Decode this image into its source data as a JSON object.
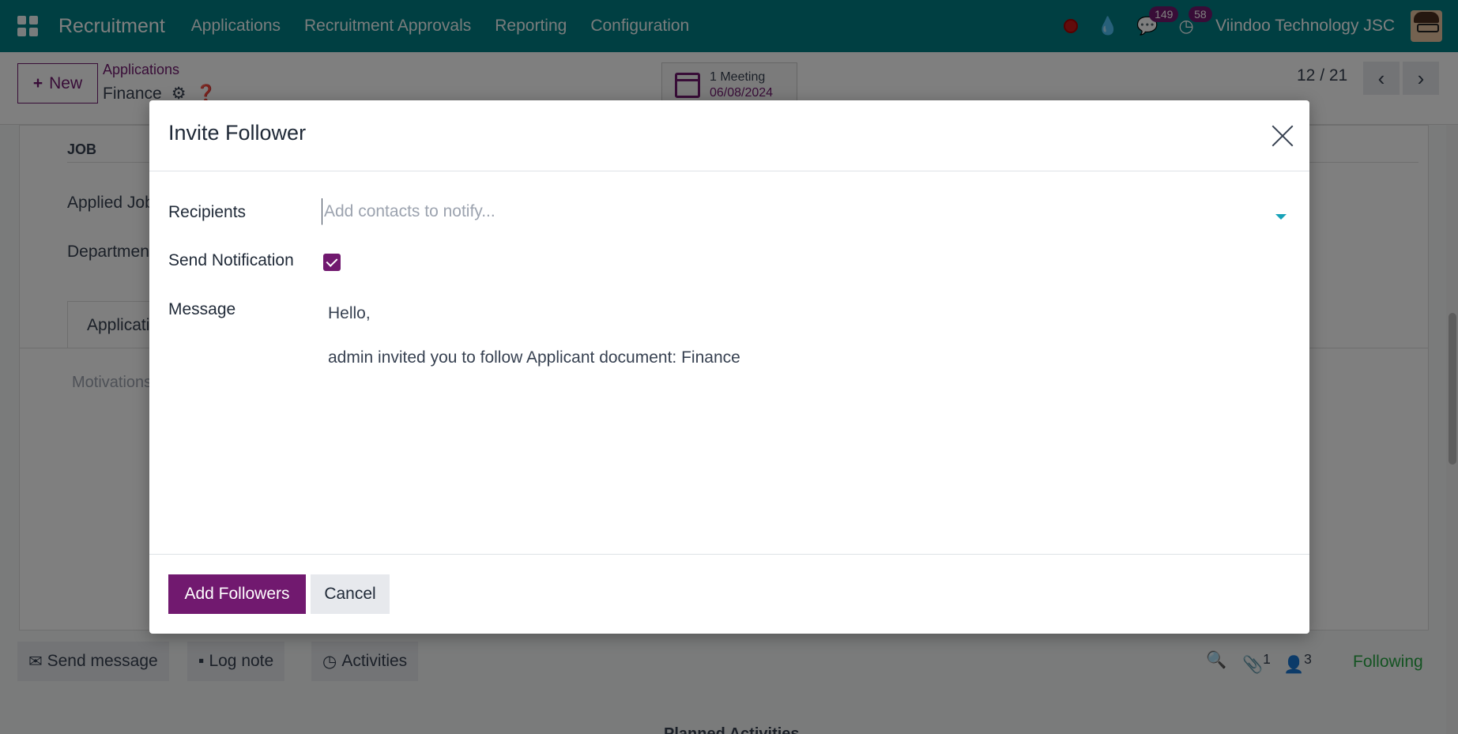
{
  "navbar": {
    "app_name": "Recruitment",
    "menu": [
      "Applications",
      "Recruitment Approvals",
      "Reporting",
      "Configuration"
    ],
    "messages_count": "149",
    "activities_count": "58",
    "company": "Viindoo Technology JSC"
  },
  "control": {
    "new_label": "New",
    "breadcrumb_parent": "Applications",
    "breadcrumb_current": "Finance",
    "meeting_label": "1 Meeting",
    "meeting_date": "06/08/2024",
    "pager": "12 / 21"
  },
  "form": {
    "section_job": "JOB",
    "applied_job_label": "Applied Job",
    "department_label": "Department",
    "tab_application": "Applicatio",
    "motivations_placeholder": "Motivations..."
  },
  "chatter": {
    "send_message": "Send message",
    "log_note": "Log note",
    "activities": "Activities",
    "attachments_count": "1",
    "followers_count": "3",
    "following": "Following",
    "planned_activities": "Planned Activities"
  },
  "dialog": {
    "title": "Invite Follower",
    "recipients_label": "Recipients",
    "recipients_placeholder": "Add contacts to notify...",
    "send_notification_label": "Send Notification",
    "send_notification_checked": true,
    "message_label": "Message",
    "message_lines": [
      "Hello,",
      "admin invited you to follow Applicant document: Finance"
    ],
    "add_followers_label": "Add Followers",
    "cancel_label": "Cancel"
  },
  "colors": {
    "navbar": "#017e84",
    "primary": "#71196f",
    "following": "#28a745"
  }
}
